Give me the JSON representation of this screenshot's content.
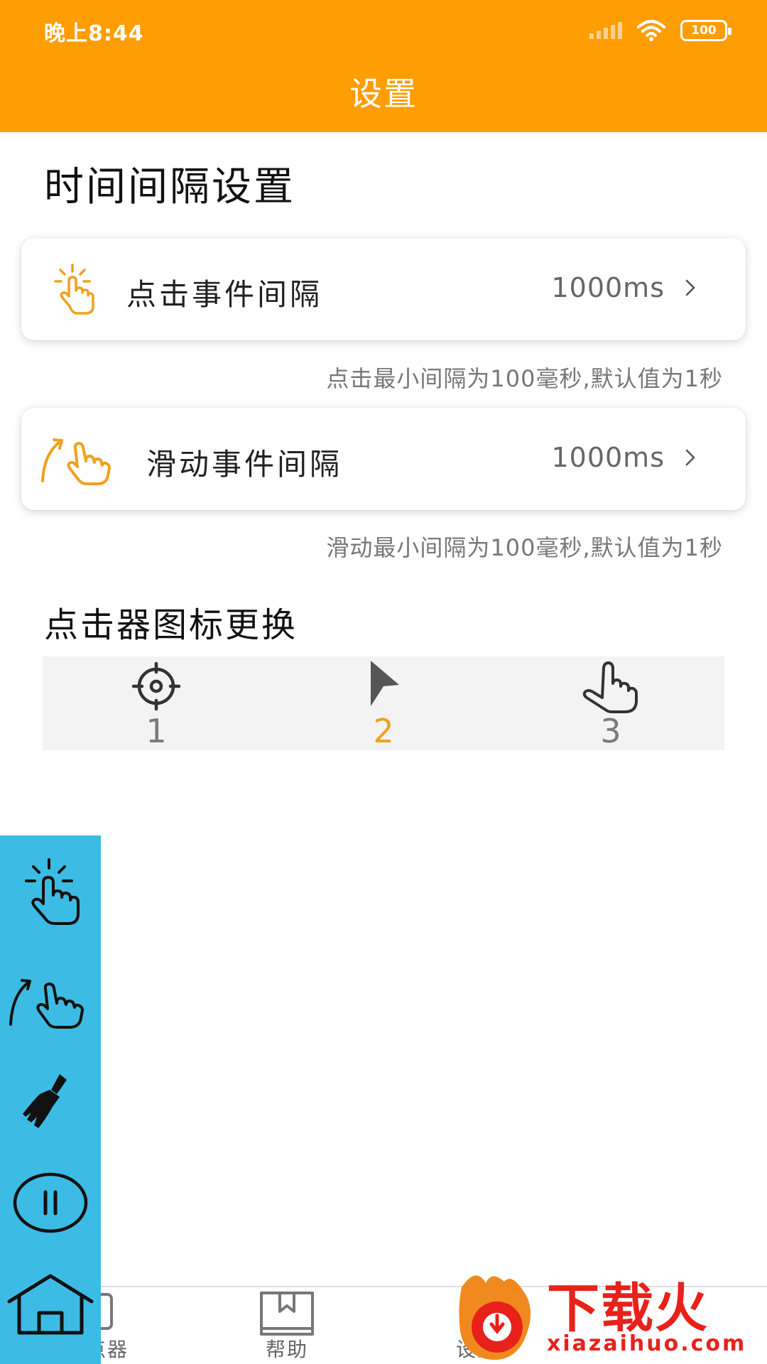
{
  "status_bar": {
    "time": "晚上8:44",
    "battery": "100"
  },
  "header": {
    "title": "设置"
  },
  "interval_section": {
    "title": "时间间隔设置",
    "click_interval": {
      "label": "点击事件间隔",
      "value": "1000ms",
      "hint": "点击最小间隔为100毫秒,默认值为1秒",
      "icon": "tap-hand-icon"
    },
    "swipe_interval": {
      "label": "滑动事件间隔",
      "value": "1000ms",
      "hint": "滑动最小间隔为100毫秒,默认值为1秒",
      "icon": "swipe-hand-icon"
    }
  },
  "icon_section": {
    "title": "点击器图标更换",
    "options": [
      {
        "num": "1",
        "icon": "crosshair-icon"
      },
      {
        "num": "2",
        "icon": "arrow-pointer-icon"
      },
      {
        "num": "3",
        "icon": "pointing-hand-icon"
      }
    ],
    "selected": "2"
  },
  "floating_panel": {
    "buttons": [
      "tap-hand-icon",
      "swipe-hand-icon",
      "broom-icon",
      "pause-icon",
      "home-icon"
    ]
  },
  "bottom_nav": {
    "items": [
      {
        "label": "连点器",
        "icon": "clicker-icon"
      },
      {
        "label": "帮助",
        "icon": "book-icon"
      },
      {
        "label": "设置",
        "icon": "gear-icon"
      }
    ]
  },
  "watermark": {
    "text": "下载火",
    "url": "xiazaihuo.com"
  },
  "colors": {
    "accent": "#FF9D05",
    "panel": "#3CBCE4",
    "selected": "#F0A020",
    "watermark": "#E8211B"
  }
}
